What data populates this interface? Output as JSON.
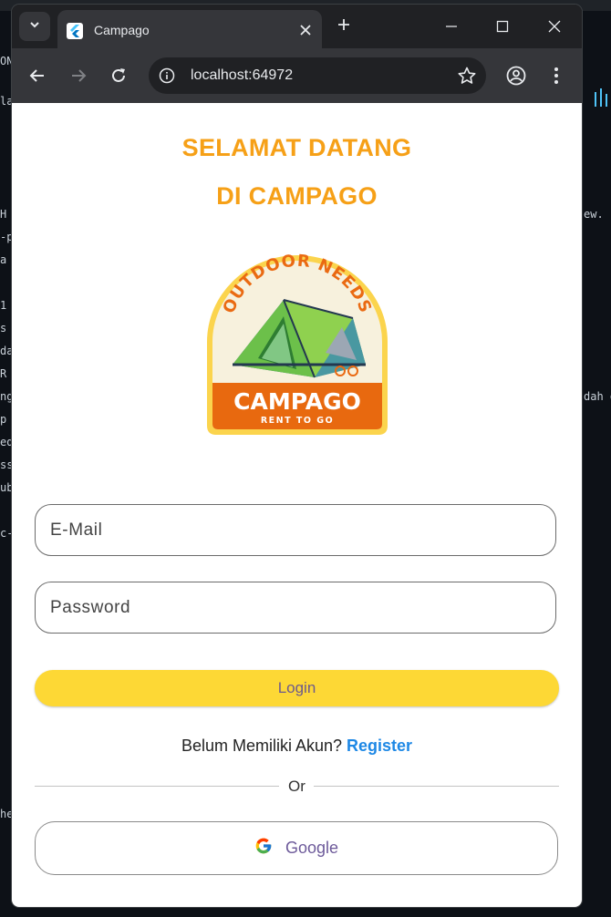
{
  "browser": {
    "tab_title": "Campago",
    "new_tab_symbol": "+",
    "url": "localhost:64972"
  },
  "page": {
    "welcome_line1": "SELAMAT DATANG",
    "welcome_line2": "DI CAMPAGO",
    "logo": {
      "top_text": "OUTDOOR NEEDS",
      "brand": "CAMPAGO",
      "tagline": "RENT TO GO"
    },
    "email_placeholder": "E-Mail",
    "password_placeholder": "Password",
    "login_label": "Login",
    "register_prompt": "Belum Memiliki Akun?",
    "register_link": "Register",
    "divider_text": "Or",
    "google_label": "Google"
  },
  "colors": {
    "accent_orange": "#f6a017",
    "login_yellow": "#fdd835",
    "link_blue": "#1e88e5",
    "button_text_purple": "#6d5a9a"
  }
}
